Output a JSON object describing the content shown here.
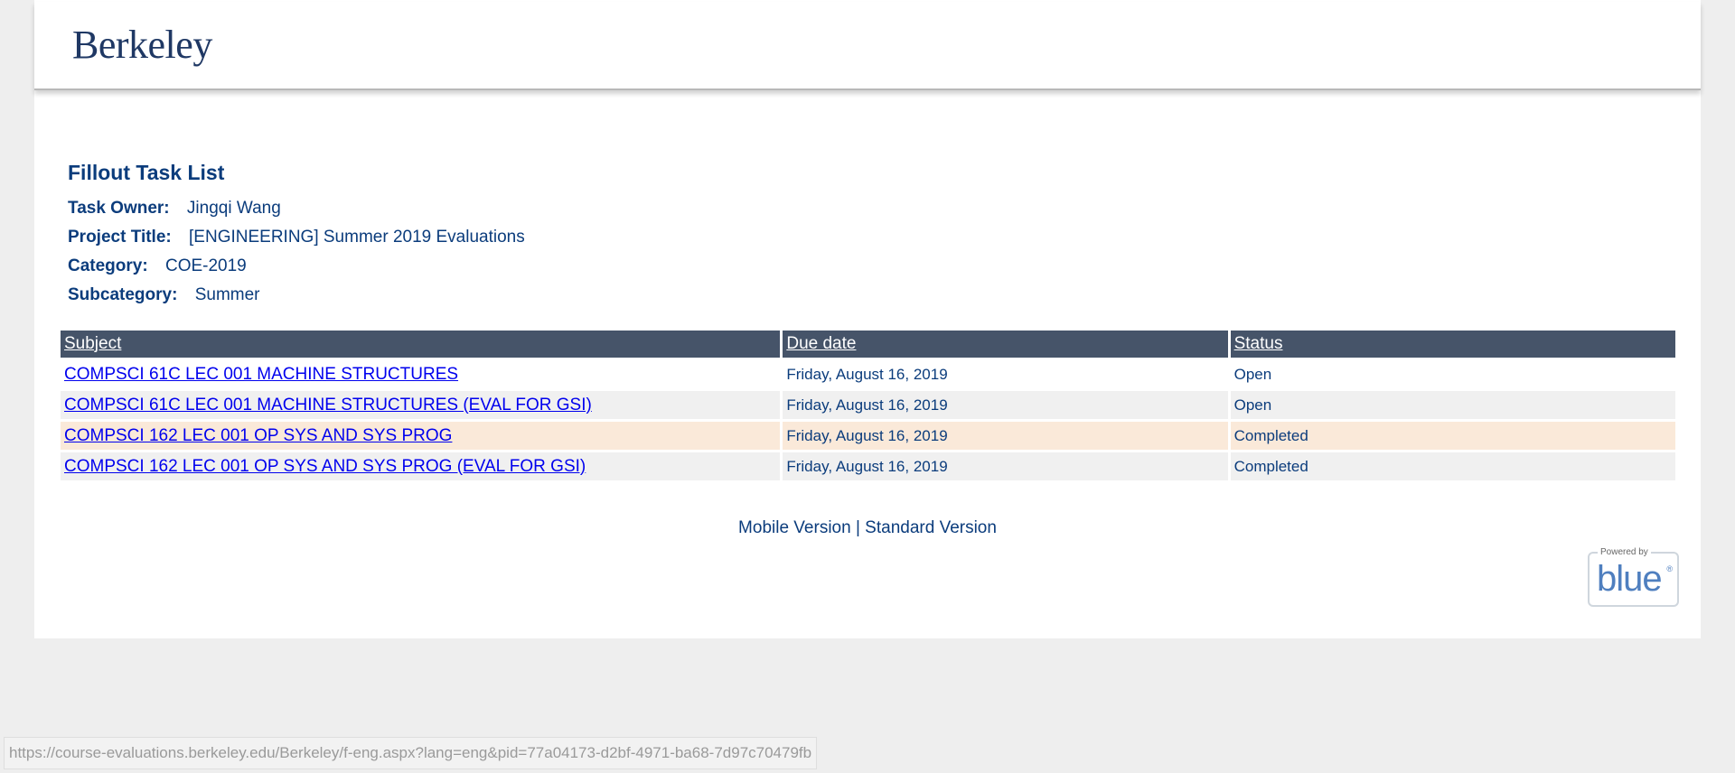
{
  "header": {
    "logo_text": "Berkeley"
  },
  "page": {
    "title": "Fillout Task List",
    "fields": [
      {
        "label": "Task Owner:",
        "value": "Jingqi Wang"
      },
      {
        "label": "Project Title:",
        "value": "[ENGINEERING] Summer 2019 Evaluations"
      },
      {
        "label": "Category:",
        "value": "COE-2019"
      },
      {
        "label": "Subcategory:",
        "value": "Summer"
      }
    ]
  },
  "table": {
    "columns": [
      "Subject",
      "Due date",
      "Status"
    ],
    "rows": [
      {
        "subject": "COMPSCI 61C LEC 001 MACHINE STRUCTURES",
        "due": "Friday, August 16, 2019",
        "status": "Open"
      },
      {
        "subject": "COMPSCI 61C LEC 001 MACHINE STRUCTURES (EVAL FOR GSI)",
        "due": "Friday, August 16, 2019",
        "status": "Open"
      },
      {
        "subject": "COMPSCI 162 LEC 001 OP SYS AND SYS PROG",
        "due": "Friday, August 16, 2019",
        "status": "Completed"
      },
      {
        "subject": "COMPSCI 162 LEC 001 OP SYS AND SYS PROG (EVAL FOR GSI)",
        "due": "Friday, August 16, 2019",
        "status": "Completed"
      }
    ]
  },
  "footer": {
    "mobile_label": "Mobile Version",
    "separator": "|",
    "standard_label": "Standard Version",
    "powered_by": "Powered by",
    "powered_brand": "blue",
    "powered_reg": "®"
  },
  "statusbar": {
    "url": "https://course-evaluations.berkeley.edu/Berkeley/f-eng.aspx?lang=eng&pid=77a04173-d2bf-4971-ba68-7d97c70479fb"
  },
  "colors": {
    "title_blue": "#0b3c7c",
    "table_header_bg": "#465469",
    "link_blue": "#0000ee",
    "completed_row_bg": "#fae9d9"
  }
}
